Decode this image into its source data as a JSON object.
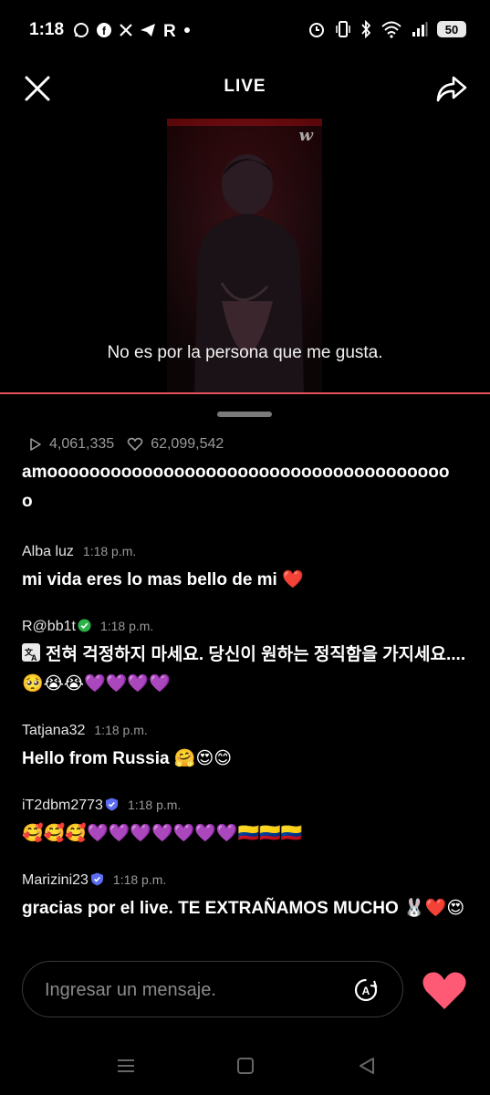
{
  "status_bar": {
    "time": "1:18",
    "battery": "50",
    "left_icons": [
      "whatsapp-icon",
      "facebook-icon",
      "x-icon",
      "telegram-icon",
      "reddit-r-icon",
      "dot-icon"
    ],
    "right_icons": [
      "alarm-icon",
      "vibrate-icon",
      "bluetooth-icon",
      "wifi-icon",
      "signal-icon",
      "battery-icon"
    ]
  },
  "header": {
    "title": "LIVE"
  },
  "video": {
    "logo": "w",
    "subtitle": "No es por la persona que me gusta."
  },
  "stats": {
    "views": "4,061,335",
    "likes": "62,099,542"
  },
  "chat": {
    "continued_text": "amoooooooooooooooooooooooooooooooooooooo\no",
    "messages": [
      {
        "user": "Alba luz",
        "time": "1:18 p.m.",
        "badge": "",
        "text": "mi vida eres lo mas bello de mi ❤️"
      },
      {
        "user": "R@bb1t",
        "time": "1:18 p.m.",
        "badge": "green-check",
        "translated": true,
        "text": "전혀 걱정하지 마세요. 당신이 원하는 정직함을 가지세요.... 🥺😭😭💜💜💜💜"
      },
      {
        "user": "Tatjana32",
        "time": "1:18 p.m.",
        "badge": "",
        "text": "Hello from Russia 🤗😍😊"
      },
      {
        "user": "iT2dbm2773",
        "time": "1:18 p.m.",
        "badge": "blue-shield",
        "text": "🥰🥰🥰💜💜💜💜💜💜💜🇨🇴🇨🇴🇨🇴"
      },
      {
        "user": "Marizini23",
        "time": "1:18 p.m.",
        "badge": "blue-shield",
        "text": "gracias por el live. TE EXTRAÑAMOS MUCHO 🐰❤️😍"
      }
    ]
  },
  "input": {
    "placeholder": "Ingresar un mensaje."
  },
  "nav": {
    "buttons": [
      "recents-icon",
      "home-icon",
      "back-icon"
    ]
  },
  "colors": {
    "accent_red": "#e8505b",
    "heart": "#ff5a75",
    "green_badge": "#2bb34a",
    "blue_badge": "#5b6cf0"
  }
}
